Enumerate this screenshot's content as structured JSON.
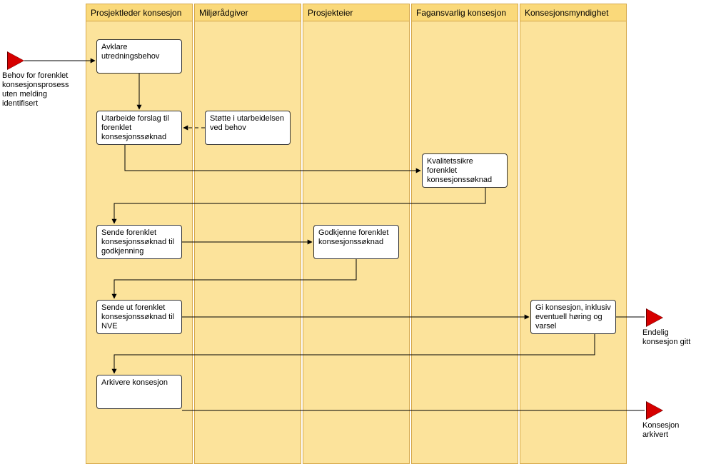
{
  "lanes": {
    "l1": "Prosjektleder konsesjon",
    "l2": "Miljørådgiver",
    "l3": "Prosjekteier",
    "l4": "Fagansvarlig konsesjon",
    "l5": "Konsesjonsmyndighet"
  },
  "boxes": {
    "b1": "Avklare utredningsbehov",
    "b2": "Utarbeide forslag til forenklet konsesjonssøknad",
    "b3": "Støtte i utarbeidelsen ved behov",
    "b4": "Kvalitetssikre forenklet konsesjonssøknad",
    "b5": "Sende forenklet konsesjonssøknad til godkjenning",
    "b6": "Godkjenne forenklet konsesjonssøknad",
    "b7": "Sende ut forenklet konsesjonssøknad til NVE",
    "b8": "Gi konsesjon, inklusiv eventuell høring og varsel",
    "b9": "Arkivere konsesjon"
  },
  "events": {
    "e_start": "Behov for forenklet konsesjonsprosess uten melding identifisert",
    "e_end1": "Endelig konsesjon gitt",
    "e_end2": "Konsesjon arkivert"
  },
  "chart_data": {
    "type": "swimlane-process",
    "lanes": [
      "Prosjektleder konsesjon",
      "Miljørådgiver",
      "Prosjekteier",
      "Fagansvarlig konsesjon",
      "Konsesjonsmyndighet"
    ],
    "nodes": [
      {
        "id": "start",
        "type": "start-event",
        "lane": null,
        "label": "Behov for forenklet konsesjonsprosess uten melding identifisert"
      },
      {
        "id": "n1",
        "type": "task",
        "lane": "Prosjektleder konsesjon",
        "label": "Avklare utredningsbehov"
      },
      {
        "id": "n2",
        "type": "task",
        "lane": "Prosjektleder konsesjon",
        "label": "Utarbeide forslag til forenklet konsesjonssøknad"
      },
      {
        "id": "n3",
        "type": "task",
        "lane": "Miljørådgiver",
        "label": "Støtte i utarbeidelsen ved behov"
      },
      {
        "id": "n4",
        "type": "task",
        "lane": "Fagansvarlig konsesjon",
        "label": "Kvalitetssikre forenklet konsesjonssøknad"
      },
      {
        "id": "n5",
        "type": "task",
        "lane": "Prosjektleder konsesjon",
        "label": "Sende forenklet konsesjonssøknad til godkjenning"
      },
      {
        "id": "n6",
        "type": "task",
        "lane": "Prosjekteier",
        "label": "Godkjenne forenklet konsesjonssøknad"
      },
      {
        "id": "n7",
        "type": "task",
        "lane": "Prosjektleder konsesjon",
        "label": "Sende ut forenklet konsesjonssøknad til NVE"
      },
      {
        "id": "n8",
        "type": "task",
        "lane": "Konsesjonsmyndighet",
        "label": "Gi konsesjon, inklusiv eventuell høring og varsel"
      },
      {
        "id": "n9",
        "type": "task",
        "lane": "Prosjektleder konsesjon",
        "label": "Arkivere konsesjon"
      },
      {
        "id": "end1",
        "type": "end-event",
        "lane": null,
        "label": "Endelig konsesjon gitt"
      },
      {
        "id": "end2",
        "type": "end-event",
        "lane": null,
        "label": "Konsesjon arkivert"
      }
    ],
    "edges": [
      {
        "from": "start",
        "to": "n1",
        "style": "solid"
      },
      {
        "from": "n1",
        "to": "n2",
        "style": "solid"
      },
      {
        "from": "n3",
        "to": "n2",
        "style": "dashed"
      },
      {
        "from": "n2",
        "to": "n4",
        "style": "solid"
      },
      {
        "from": "n4",
        "to": "n5",
        "style": "solid"
      },
      {
        "from": "n5",
        "to": "n6",
        "style": "solid"
      },
      {
        "from": "n6",
        "to": "n7",
        "style": "solid"
      },
      {
        "from": "n7",
        "to": "n8",
        "style": "solid"
      },
      {
        "from": "n8",
        "to": "end1",
        "style": "solid"
      },
      {
        "from": "n8",
        "to": "n9",
        "style": "solid"
      },
      {
        "from": "n9",
        "to": "end2",
        "style": "solid"
      }
    ]
  }
}
